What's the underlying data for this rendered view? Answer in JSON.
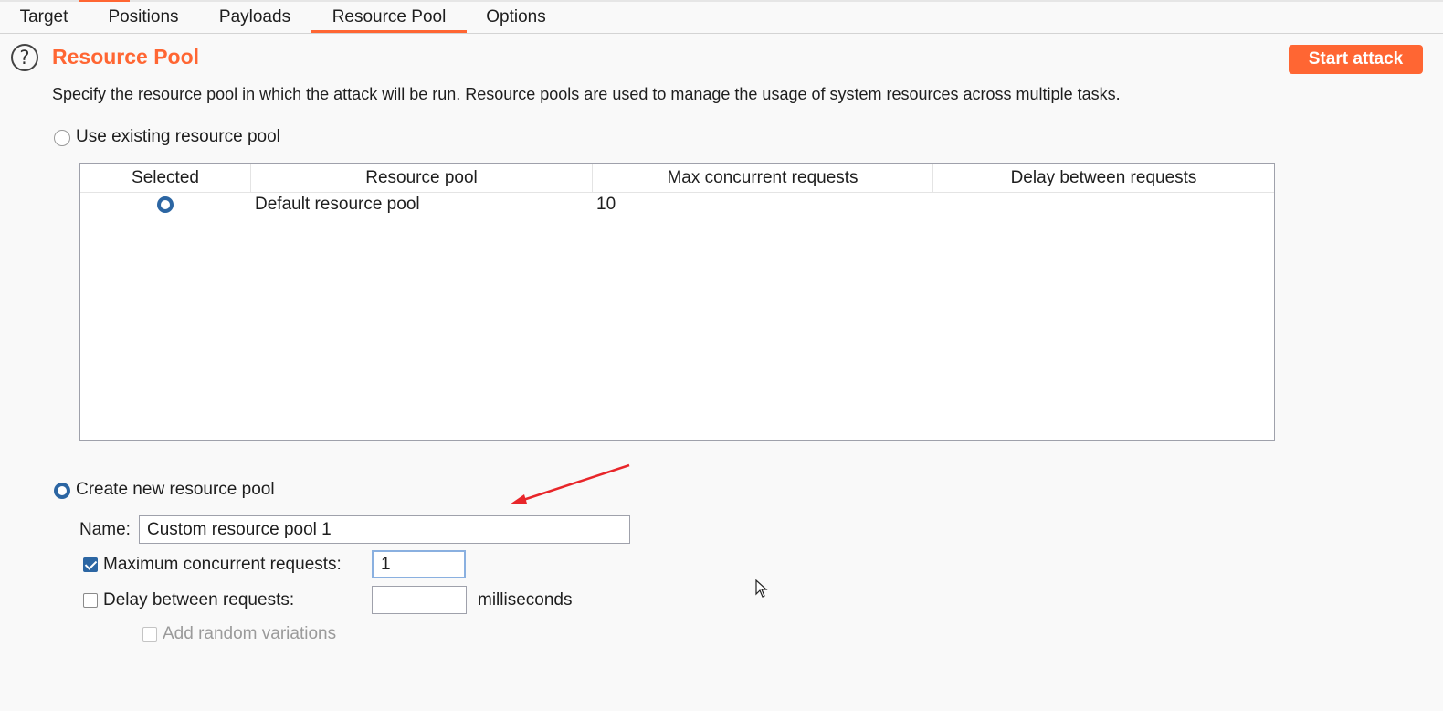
{
  "tabs": [
    {
      "label": "Target"
    },
    {
      "label": "Positions"
    },
    {
      "label": "Payloads"
    },
    {
      "label": "Resource Pool"
    },
    {
      "label": "Options"
    }
  ],
  "active_tab": "Resource Pool",
  "section": {
    "title": "Resource Pool",
    "description": "Specify the resource pool in which the attack will be run. Resource pools are used to manage the usage of system resources across multiple tasks.",
    "start_button": "Start attack"
  },
  "existing_pool": {
    "label": "Use existing resource pool",
    "selected": false,
    "table": {
      "columns": [
        "Selected",
        "Resource pool",
        "Max concurrent requests",
        "Delay between requests"
      ],
      "rows": [
        {
          "selected": true,
          "name": "Default resource pool",
          "max_concurrent": "10",
          "delay": ""
        }
      ]
    }
  },
  "new_pool": {
    "label": "Create new resource pool",
    "selected": true,
    "name_label": "Name:",
    "name_value": "Custom resource pool 1",
    "max_concurrent_label": "Maximum concurrent requests:",
    "max_concurrent_checked": true,
    "max_concurrent_value": "1",
    "delay_label": "Delay between requests:",
    "delay_checked": false,
    "delay_value": "",
    "delay_unit": "milliseconds",
    "random_label": "Add random variations",
    "random_checked": false
  },
  "colors": {
    "accent": "#ff6633",
    "radio_selected": "#2c66a3",
    "annotation_arrow": "#e8262a"
  }
}
